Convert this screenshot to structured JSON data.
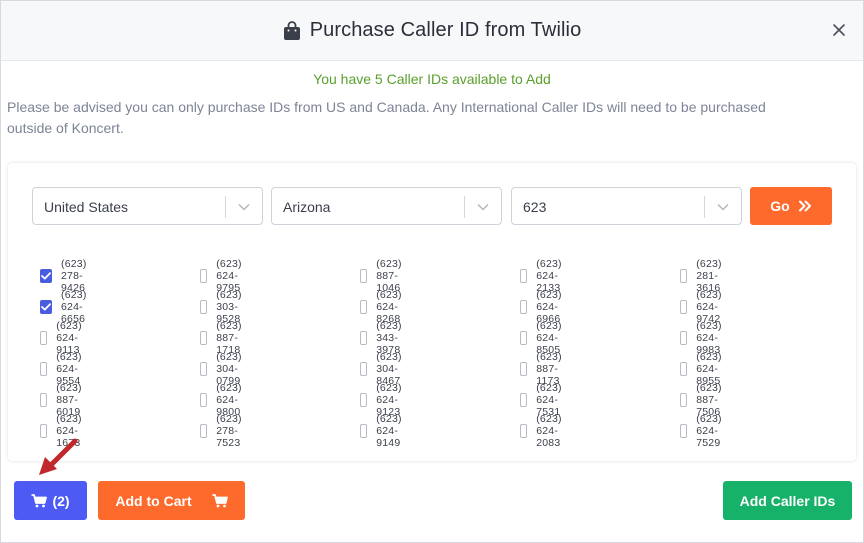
{
  "modal": {
    "title": "Purchase Caller ID from Twilio",
    "title_icon": "shopping-bag-icon",
    "close_icon": "close-icon"
  },
  "notice": {
    "available": "You have 5 Caller IDs available to Add",
    "advisory_line1": "Please be advised you can only purchase IDs from US and Canada. Any International Caller IDs will need to be purchased",
    "advisory_line2": "outside of Koncert."
  },
  "filters": {
    "country": "United States",
    "state": "Arizona",
    "area_code": "623",
    "go_label": "Go"
  },
  "numbers": [
    [
      {
        "number": "(623) 278-9426",
        "checked": true
      },
      {
        "number": "(623) 624-9795",
        "checked": false
      },
      {
        "number": "(623) 887-1046",
        "checked": false
      },
      {
        "number": "(623) 624-2133",
        "checked": false
      },
      {
        "number": "(623) 281-3616",
        "checked": false
      }
    ],
    [
      {
        "number": "(623) 624-6656",
        "checked": true
      },
      {
        "number": "(623) 303-9528",
        "checked": false
      },
      {
        "number": "(623) 624-8268",
        "checked": false
      },
      {
        "number": "(623) 624-6966",
        "checked": false
      },
      {
        "number": "(623) 624-9742",
        "checked": false
      }
    ],
    [
      {
        "number": "(623) 624-9113",
        "checked": false
      },
      {
        "number": "(623) 887-1718",
        "checked": false
      },
      {
        "number": "(623) 343-3978",
        "checked": false
      },
      {
        "number": "(623) 624-8505",
        "checked": false
      },
      {
        "number": "(623) 624-9983",
        "checked": false
      }
    ],
    [
      {
        "number": "(623) 624-9554",
        "checked": false
      },
      {
        "number": "(623) 304-0799",
        "checked": false
      },
      {
        "number": "(623) 304-8467",
        "checked": false
      },
      {
        "number": "(623) 887-1173",
        "checked": false
      },
      {
        "number": "(623) 624-8955",
        "checked": false
      }
    ],
    [
      {
        "number": "(623) 887-6019",
        "checked": false
      },
      {
        "number": "(623) 624-9800",
        "checked": false
      },
      {
        "number": "(623) 624-9123",
        "checked": false
      },
      {
        "number": "(623) 624-7531",
        "checked": false
      },
      {
        "number": "(623) 887-7506",
        "checked": false
      }
    ],
    [
      {
        "number": "(623) 624-1673",
        "checked": false
      },
      {
        "number": "(623) 278-7523",
        "checked": false
      },
      {
        "number": "(623) 624-9149",
        "checked": false
      },
      {
        "number": "(623) 624-2083",
        "checked": false
      },
      {
        "number": "(623) 624-7529",
        "checked": false
      }
    ]
  ],
  "actions": {
    "cart_count": "(2)",
    "add_to_cart": "Add to Cart",
    "add_caller_ids": "Add Caller IDs"
  },
  "colors": {
    "accent_orange": "#fe6a2c",
    "cart_blue": "#4d5bf4",
    "success_green": "#17b26a",
    "notice_green": "#5aa02c",
    "checkbox_blue": "#4a5de0",
    "annotation_arrow": "#c0282b"
  }
}
